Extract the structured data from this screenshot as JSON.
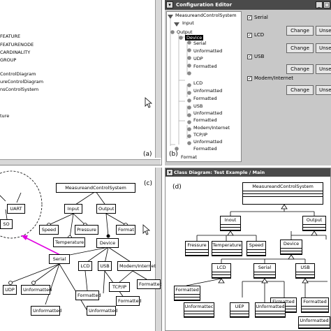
{
  "panel_a": {
    "items": [
      "FEATURE",
      "FEATURENODE",
      "CARDINALITY",
      "GROUP",
      "ControlDiagram",
      "ureControlDiagram",
      "nsControlSystem",
      "ture"
    ],
    "label": "(a)"
  },
  "panel_b": {
    "title": "Configuration Editor",
    "tree": [
      "MeasureandControlSystem",
      "Input",
      "Output",
      "Device",
      "Serial",
      "Unformatted",
      "UDP",
      "Formatted",
      "LCD",
      "Unformatted",
      "Formatted",
      "USB",
      "Unformatted",
      "Formatted",
      "Modem/Internet",
      "TCP/IP",
      "Unformatted",
      "Formatted",
      "Format"
    ],
    "options": [
      {
        "label": "Serial",
        "change": "Change",
        "other": "Unse"
      },
      {
        "label": "LCD",
        "change": "Change",
        "other": "Unse"
      },
      {
        "label": "USB",
        "change": "Change",
        "other": "Unse"
      },
      {
        "label": "Modem/Internet",
        "change": "Change",
        "other": "Unse"
      }
    ],
    "label": "(b)"
  },
  "panel_c": {
    "label": "(c)",
    "nodes": {
      "root": "MeasureandControlSystem",
      "input": "Input",
      "output": "Output",
      "speed": "Speed",
      "pressure": "Pressure",
      "temperature": "Temperature",
      "format": "Format",
      "device": "Device",
      "serial": "Serial",
      "lcd": "LCD",
      "usb": "USB",
      "modem": "Modem/Internet",
      "uart": "UART",
      "so": "SO",
      "udp": "UDP",
      "unf1": "Unformatted",
      "tcpip": "TCP/IP",
      "fmt1": "Formatted",
      "fmt2": "Formatted",
      "unf2": "Unformatted",
      "fmt3": "Formatted",
      "unf3": "Unformatted"
    }
  },
  "panel_d": {
    "title": "Class Diagram: Test Example / Main",
    "label": "(d)",
    "boxes": {
      "root": "MeasureandControlSystem",
      "input": "Inout",
      "output": "Output",
      "pressure": "Fressure",
      "temperature": "Temperature",
      "speed": "Speed",
      "device": "Device",
      "lcd": "LCD",
      "serial": "Serial",
      "usb": "USB",
      "formatted": "Formatted",
      "formatted2": "Fjrmatted",
      "formatted3": "Formatted",
      "unformatted": "Unformattec",
      "uep": "UEP",
      "unformatted2": "Unformatted",
      "unformatted3": "Unformatted"
    }
  }
}
